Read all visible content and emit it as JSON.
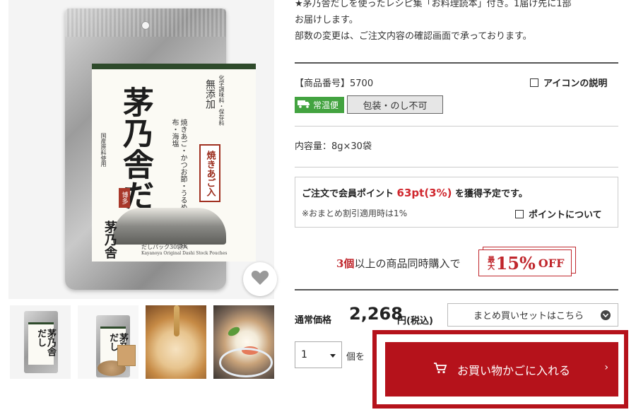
{
  "product": {
    "pouch_title": "茅乃舎だし",
    "pouch_sub_right": "無添加",
    "pouch_sub_small": "化学調味料・保存料",
    "pouch_tag": "焼きあご入",
    "pouch_side": "焼きあご・かつお節・うるめいわし 真昆布・海塩",
    "pouch_side2": "国産原料使用",
    "pouch_stamp": "博多",
    "pouch_foot": "だしパック30袋入",
    "pouch_foot_en": "Kayanoya Original Dashi Stock Pouches",
    "pouch_logo": "茅乃舎",
    "thumb_title": "茅乃舎だし"
  },
  "description": {
    "line1": "★茅乃舎だしを使ったレシピ集「お料理読本」付き。1届け先に1部",
    "line2": "お届けします。",
    "line3": "部数の変更は、ご注文内容の確認画面で承っております。"
  },
  "info": {
    "code_label": "【商品番号】5700",
    "icon_help": "アイコンの説明",
    "ship_badge": "常温便",
    "wrap_badge": "包装・のし不可",
    "volume": "内容量：8g×30袋"
  },
  "points": {
    "prefix": "ご注文で会員ポイント",
    "value": "63pt(3%)",
    "suffix": "を獲得予定です。",
    "note": "※おまとめ割引適用時は1%",
    "link": "ポイントについて"
  },
  "bulk": {
    "count": "3個",
    "text": "以上の商品同時購入で",
    "badge_small": "最大",
    "badge_big": "15%",
    "badge_off": "OFF"
  },
  "price": {
    "label": "通常価格",
    "amount": "2,268",
    "suffix": "円(税込)",
    "set_select": "まとめ買いセットはこちら"
  },
  "order": {
    "qty": "1",
    "unit": "個を",
    "cart_button": "お買い物かごに入れる"
  },
  "colors": {
    "accent_red": "#b5121b",
    "ship_green": "#43a340",
    "point_red": "#d0262d"
  },
  "icons": [
    "heart-icon",
    "truck-icon",
    "cart-icon",
    "chevron-down-icon",
    "chevron-right-icon",
    "checkbox-icon"
  ]
}
